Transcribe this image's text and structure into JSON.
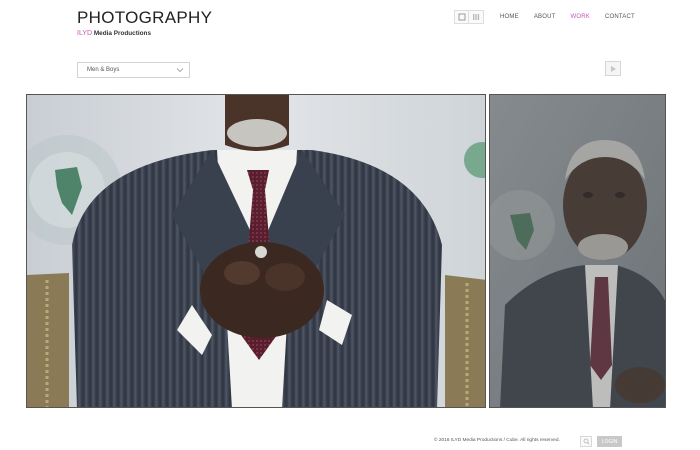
{
  "header": {
    "title": "PHOTOGRAPHY",
    "brand": "ILYD",
    "subtitle": "Media Productions"
  },
  "view_toggle": {
    "icons": [
      "single-view-icon",
      "grid-view-icon"
    ]
  },
  "nav": {
    "items": [
      {
        "label": "HOME",
        "active": false
      },
      {
        "label": "ABOUT",
        "active": false
      },
      {
        "label": "WORK",
        "active": true
      },
      {
        "label": "CONTACT",
        "active": false
      }
    ]
  },
  "filter": {
    "selected": "Men & Boys"
  },
  "gallery": {
    "play_icon": "play-icon",
    "photos": [
      "portrait-main",
      "portrait-side"
    ]
  },
  "footer": {
    "copyright": "© 2016 ILYD Media Productions / Cube. All rights reserved.",
    "login_label": "LOGIN"
  },
  "colors": {
    "accent": "#c455b7",
    "background": "#ffffff",
    "suit": "#3c4350",
    "tie": "#5a1d2e"
  }
}
